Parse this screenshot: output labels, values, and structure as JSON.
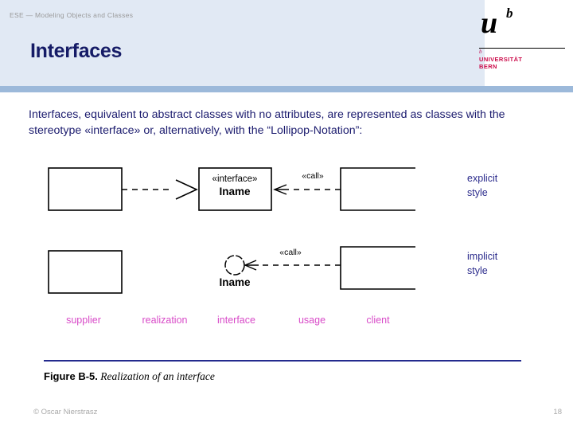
{
  "header": {
    "course_line": "ESE — Modeling Objects and Classes",
    "title": "Interfaces"
  },
  "logo": {
    "mark_u": "u",
    "mark_b": "b",
    "tiny_b": "b",
    "university_line1": "UNIVERSITÄT",
    "university_line2": "BERN",
    "accent_color": "#cc0b4a"
  },
  "body": {
    "paragraph": "Interfaces, equivalent to abstract classes with no attributes, are represented as classes with the stereotype «interface» or, alternatively, with the “Lollipop-Notation”:",
    "text_color": "#1b1b6e"
  },
  "figure": {
    "explicit_row": {
      "supplier_box_label": "",
      "interface_stereotype": "«interface»",
      "interface_name": "Iname",
      "usage_label": "«call»",
      "client_box_label": "",
      "style_note_line1": "explicit",
      "style_note_line2": "style"
    },
    "implicit_row": {
      "supplier_box_label": "",
      "lollipop_name": "Iname",
      "usage_label": "«call»",
      "client_box_label": "",
      "style_note_line1": "implicit",
      "style_note_line2": "style"
    },
    "role_labels": [
      "supplier",
      "realization",
      "interface",
      "usage",
      "client"
    ],
    "role_label_color": "#d84bc8",
    "style_note_color": "#2b2b8c"
  },
  "caption": {
    "number": "Figure B-5.",
    "title": "Realization of an interface",
    "rule_color": "#232a8e"
  },
  "footer": {
    "copyright": "© Oscar Nierstrasz",
    "page_number": "18"
  }
}
